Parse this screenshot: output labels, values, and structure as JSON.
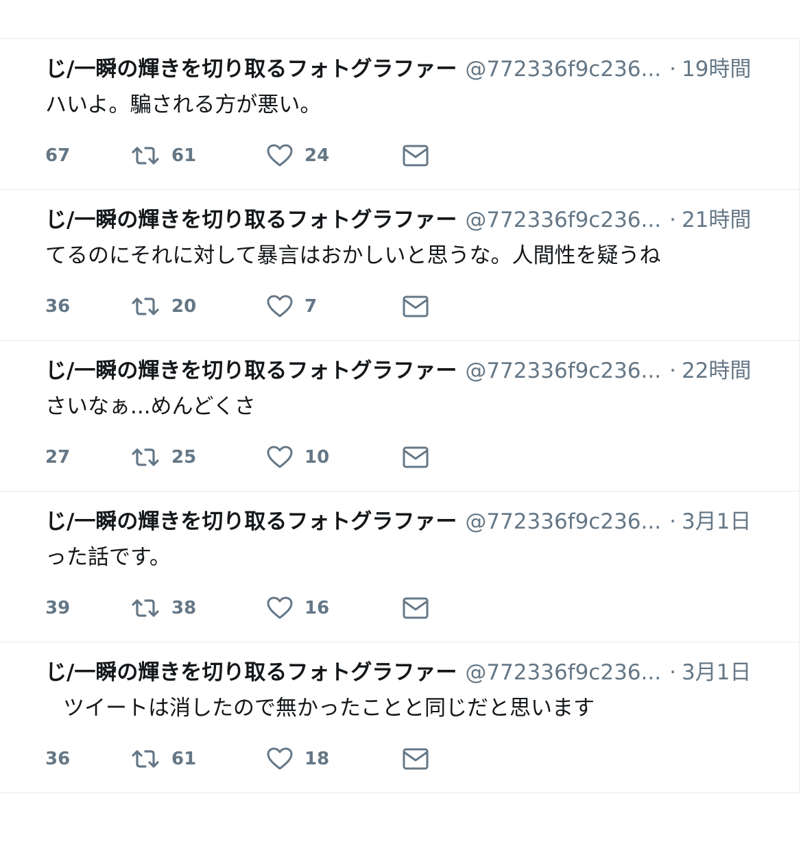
{
  "tweets": [
    {
      "name": "じ/一瞬の輝きを切り取るフォトグラファー",
      "handle": "@772336f9c236...",
      "time": "19時間",
      "text": "ハいよ。騙される方が悪い。",
      "replies": "67",
      "retweets": "61",
      "likes": "24"
    },
    {
      "name": "じ/一瞬の輝きを切り取るフォトグラファー",
      "handle": "@772336f9c236...",
      "time": "21時間",
      "text": "てるのにそれに対して暴言はおかしいと思うな。人間性を疑うね",
      "replies": "36",
      "retweets": "20",
      "likes": "7"
    },
    {
      "name": "じ/一瞬の輝きを切り取るフォトグラファー",
      "handle": "@772336f9c236...",
      "time": "22時間",
      "text": "さいなぁ...めんどくさ",
      "replies": "27",
      "retweets": "25",
      "likes": "10"
    },
    {
      "name": "じ/一瞬の輝きを切り取るフォトグラファー",
      "handle": "@772336f9c236...",
      "time": "3月1日",
      "text": "った話です。",
      "replies": "39",
      "retweets": "38",
      "likes": "16"
    },
    {
      "name": "じ/一瞬の輝きを切り取るフォトグラファー",
      "handle": "@772336f9c236...",
      "time": "3月1日",
      "text": "ツイートは消したので無かったことと同じだと思います",
      "replies": "36",
      "retweets": "61",
      "likes": "18"
    }
  ],
  "icons": {
    "retweet": "retweet-icon",
    "like": "heart-icon",
    "dm": "envelope-icon"
  },
  "colors": {
    "text": "#14171a",
    "secondary": "#657786",
    "divider": "#e6ecf0"
  }
}
